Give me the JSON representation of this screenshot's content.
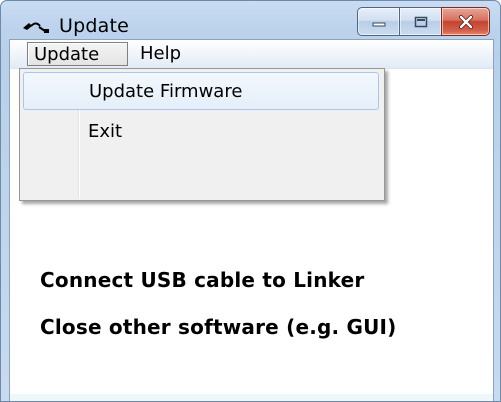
{
  "window": {
    "title": "Update",
    "icon": "usb-cable-icon",
    "controls": {
      "minimize": "minimize-icon",
      "maximize": "maximize-icon",
      "close": "close-icon"
    }
  },
  "menubar": {
    "items": [
      {
        "label": "Update",
        "active": true
      },
      {
        "label": "Help",
        "active": false
      }
    ]
  },
  "dropdown": {
    "items": [
      {
        "label": "Update Firmware",
        "highlighted": true
      },
      {
        "label": "Exit",
        "highlighted": false
      }
    ]
  },
  "content": {
    "line1": "Connect USB cable to Linker",
    "line2": "Close other software (e.g. GUI)"
  },
  "colors": {
    "close_button": "#c24430",
    "highlight_border": "#a9c7ea"
  }
}
